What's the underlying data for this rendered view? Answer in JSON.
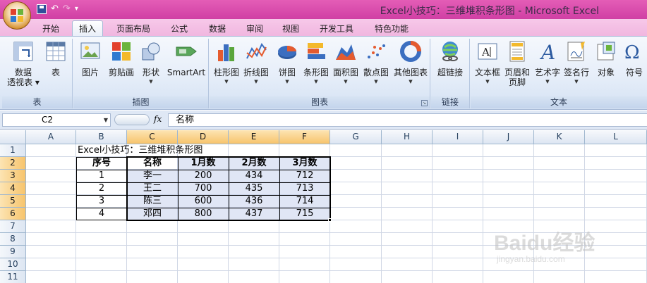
{
  "window": {
    "title": "Excel小技巧：三维堆积条形图 - Microsoft Excel"
  },
  "quick_access": {
    "undo_icon": "↶",
    "redo_icon": "↷",
    "customize_icon": "▾"
  },
  "tabs": [
    {
      "label": "开始",
      "active": false
    },
    {
      "label": "插入",
      "active": true
    },
    {
      "label": "页面布局",
      "active": false
    },
    {
      "label": "公式",
      "active": false
    },
    {
      "label": "数据",
      "active": false
    },
    {
      "label": "审阅",
      "active": false
    },
    {
      "label": "视图",
      "active": false
    },
    {
      "label": "开发工具",
      "active": false
    },
    {
      "label": "特色功能",
      "active": false
    }
  ],
  "ribbon": {
    "groups": {
      "tables": "表",
      "illustrations": "插图",
      "charts": "图表",
      "links": "链接",
      "text": "文本"
    },
    "buttons": {
      "pivot_table_l1": "数据",
      "pivot_table_l2": "透视表",
      "table": "表",
      "picture": "图片",
      "clipart": "剪贴画",
      "shapes": "形状",
      "smartart": "SmartArt",
      "column": "柱形图",
      "line": "折线图",
      "pie": "饼图",
      "bar": "条形图",
      "area": "面积图",
      "scatter": "散点图",
      "other": "其他图表",
      "hyperlink": "超链接",
      "textbox": "文本框",
      "header_footer_l1": "页眉和",
      "header_footer_l2": "页脚",
      "wordart": "艺术字",
      "signature": "签名行",
      "object": "对象",
      "symbol": "符号"
    }
  },
  "formula_bar": {
    "name_box": "C2",
    "fx": "fx",
    "content": "名称"
  },
  "columns": [
    "A",
    "B",
    "C",
    "D",
    "E",
    "F",
    "G",
    "H",
    "I",
    "J",
    "K",
    "L"
  ],
  "rows": [
    "1",
    "2",
    "3",
    "4",
    "5",
    "6",
    "7",
    "8",
    "9",
    "10",
    "11"
  ],
  "sheet": {
    "a1_title": "Excel小技巧：三维堆积条形图",
    "headers": [
      "序号",
      "名称",
      "1月数",
      "2月数",
      "3月数"
    ],
    "data": [
      [
        "1",
        "李一",
        "200",
        "434",
        "712"
      ],
      [
        "2",
        "王二",
        "700",
        "435",
        "713"
      ],
      [
        "3",
        "陈三",
        "600",
        "436",
        "714"
      ],
      [
        "4",
        "邓四",
        "800",
        "437",
        "715"
      ]
    ]
  },
  "watermark": {
    "main": "Baidu经验",
    "sub": "jingyan.baidu.com"
  }
}
